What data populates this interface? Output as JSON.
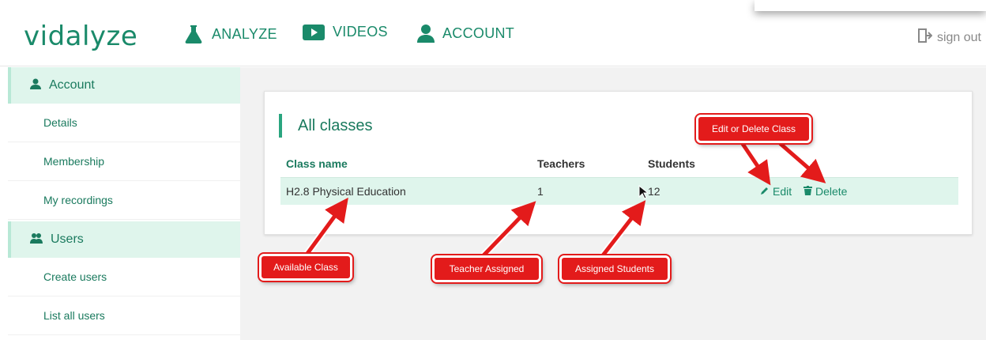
{
  "brand": {
    "logo": "vidalyze",
    "accent": "#1a8a6a"
  },
  "nav": {
    "items": [
      {
        "label": "ANALYZE",
        "icon": "flask-icon"
      },
      {
        "label": "VIDEOS",
        "icon": "video-play-icon"
      },
      {
        "label": "ACCOUNT",
        "icon": "user-icon"
      }
    ],
    "signout": "sign out"
  },
  "sidebar": {
    "account_header": "Account",
    "account_items": [
      "Details",
      "Membership",
      "My recordings"
    ],
    "users_header": "Users",
    "users_items": [
      "Create users",
      "List all users"
    ]
  },
  "main": {
    "title": "All classes",
    "columns": [
      "Class name",
      "Teachers",
      "Students"
    ],
    "rows": [
      {
        "name": "H2.8 Physical Education",
        "teachers": "1",
        "students": "12",
        "edit": "Edit",
        "delete": "Delete"
      }
    ]
  },
  "callouts": {
    "edit_delete": "Edit or Delete Class",
    "available": "Available Class",
    "teacher": "Teacher Assigned",
    "students": "Assigned Students"
  }
}
